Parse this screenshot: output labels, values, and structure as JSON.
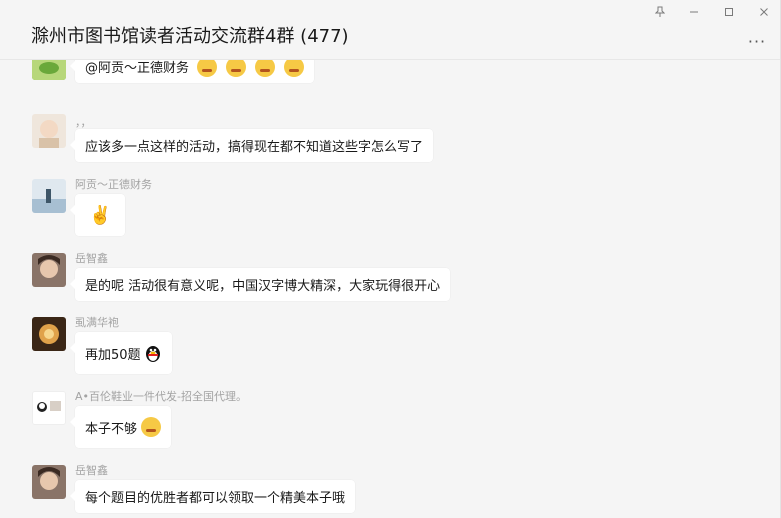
{
  "window": {
    "title": "滁州市图书馆读者活动交流群4群 (477)",
    "controls": {
      "pin": "⚲",
      "minimize": "–",
      "maximize": "☐",
      "close": "✕"
    },
    "more": "···"
  },
  "messages": [
    {
      "sender": "",
      "text": "@阿贡～正德财务",
      "avatar_color": "#8bc34a",
      "emoji_count": 4,
      "emoji_name": "grimace-emoji"
    },
    {
      "sender": "，，",
      "text": "应该多一点这样的活动，搞得现在都不知道这些字怎么写了",
      "avatar_color": "#e8ddd0"
    },
    {
      "sender": "阿贡～正德财务",
      "text": "✌️",
      "avatar_color": "#cfdbe6"
    },
    {
      "sender": "岳智鑫",
      "text": "是的呢 活动很有意义呢，中国汉字博大精深，大家玩得很开心",
      "avatar_color": "#6b5a52"
    },
    {
      "sender": "虱满华袍",
      "text": "再加50题",
      "avatar_color": "#c58a3b"
    },
    {
      "sender": "A•百伦鞋业一件代发-招全国代理。",
      "text": "本子不够",
      "avatar_color": "#ffffff"
    },
    {
      "sender": "岳智鑫",
      "text": "每个题目的优胜者都可以领取一个精美本子哦",
      "avatar_color": "#6b5a52"
    }
  ]
}
